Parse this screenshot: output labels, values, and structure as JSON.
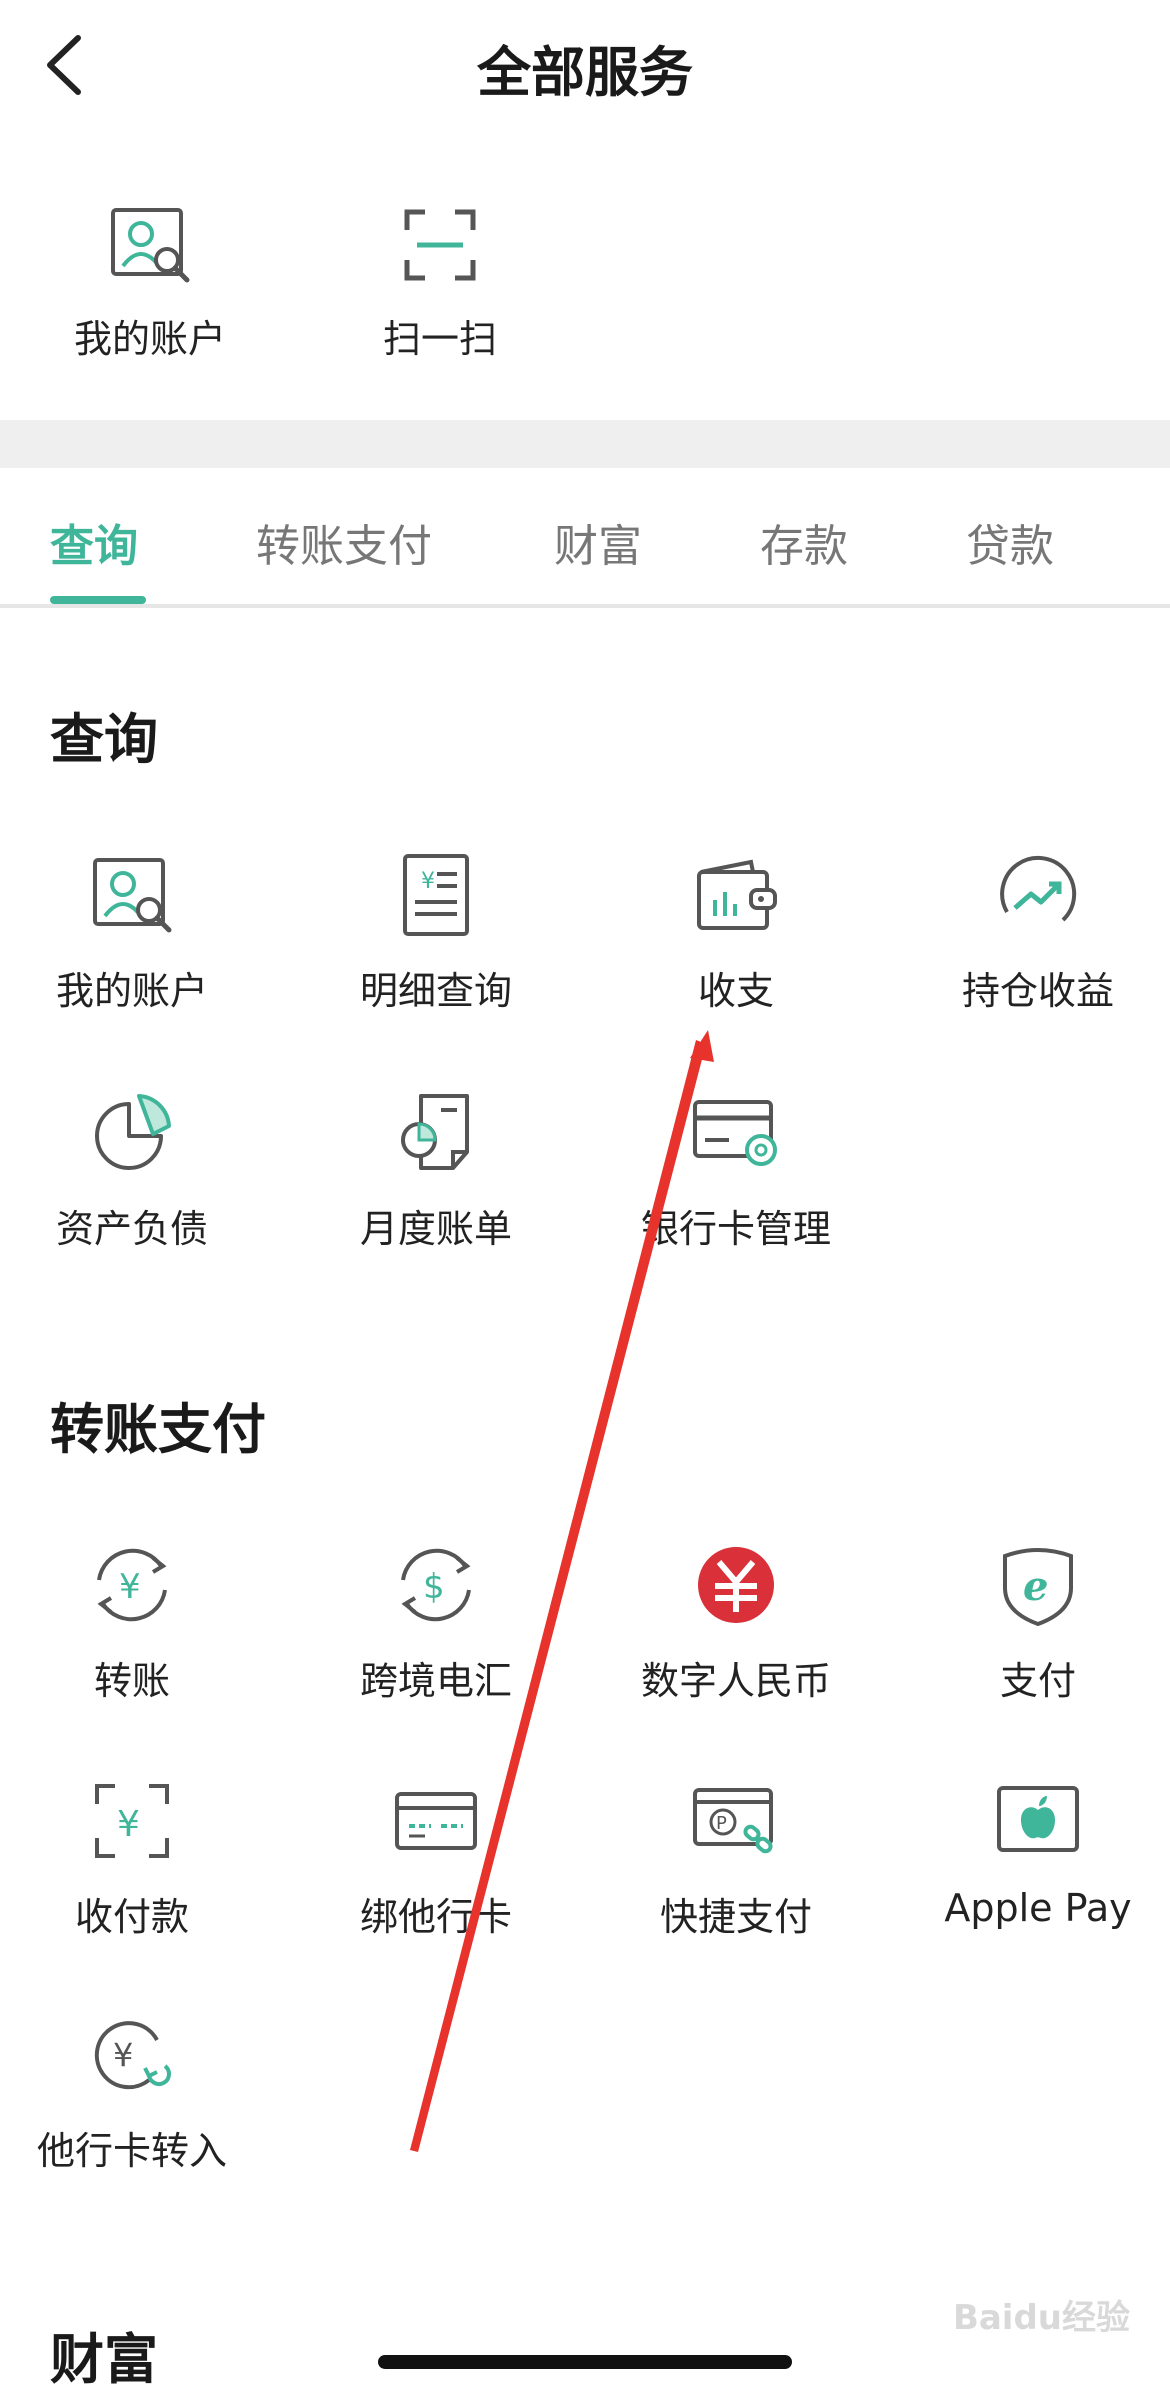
{
  "header": {
    "title": "全部服务"
  },
  "quick": [
    {
      "label": "我的账户",
      "icon": "account-search-icon"
    },
    {
      "label": "扫一扫",
      "icon": "scan-icon"
    }
  ],
  "tabs": [
    {
      "label": "查询",
      "active": true
    },
    {
      "label": "转账支付",
      "active": false
    },
    {
      "label": "财富",
      "active": false
    },
    {
      "label": "存款",
      "active": false
    },
    {
      "label": "贷款",
      "active": false
    }
  ],
  "sections": {
    "query": {
      "title": "查询",
      "items": [
        {
          "label": "我的账户",
          "icon": "account-search-icon"
        },
        {
          "label": "明细查询",
          "icon": "statement-icon"
        },
        {
          "label": "收支",
          "icon": "wallet-icon"
        },
        {
          "label": "持仓收益",
          "icon": "trend-icon"
        },
        {
          "label": "资产负债",
          "icon": "pie-chart-icon"
        },
        {
          "label": "月度账单",
          "icon": "monthly-bill-icon"
        },
        {
          "label": "银行卡管理",
          "icon": "card-settings-icon"
        }
      ]
    },
    "transfer": {
      "title": "转账支付",
      "items": [
        {
          "label": "转账",
          "icon": "transfer-yuan-icon"
        },
        {
          "label": "跨境电汇",
          "icon": "transfer-dollar-icon"
        },
        {
          "label": "数字人民币",
          "icon": "digital-rmb-icon"
        },
        {
          "label": "支付",
          "icon": "e-pay-shield-icon"
        },
        {
          "label": "收付款",
          "icon": "scan-yuan-icon"
        },
        {
          "label": "绑他行卡",
          "icon": "bind-card-icon"
        },
        {
          "label": "快捷支付",
          "icon": "quick-pay-icon"
        },
        {
          "label": "Apple Pay",
          "icon": "apple-icon"
        },
        {
          "label": "他行卡转入",
          "icon": "card-transfer-in-icon"
        }
      ]
    },
    "wealth": {
      "title": "财富"
    }
  },
  "colors": {
    "accent": "#3fb59a",
    "digital_rmb": "#d9303a",
    "annotation_arrow": "#e8332c"
  },
  "watermark": "Baidu经验"
}
